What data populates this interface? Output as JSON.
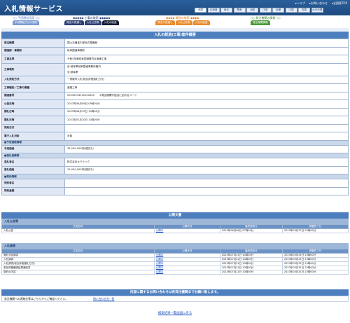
{
  "header": {
    "brand": "入札情報サービス",
    "links": [
      "▸ヘルプ",
      "▸お問い合わせ",
      "▸全国版TOP"
    ],
    "regions": [
      "全国",
      "北海道",
      "東北",
      "関東",
      "北陸",
      "中部",
      "近畿",
      "中国",
      "四国",
      "九州沖縄"
    ]
  },
  "nav": {
    "groups": [
      {
        "title": "◇◇ 手続開始画面 ◇◇",
        "tabs": [
          {
            "label": "手続開始方法の選択",
            "color": "#7a9ad0"
          }
        ],
        "color": "#5b7fc8"
      },
      {
        "title": "◆◆◆◆◆ 工事の検索 ◆◆◆◆◆",
        "tabs": [
          {
            "label": "発注の見通し",
            "color": "#2c3f73"
          },
          {
            "label": "入札公告等",
            "color": "#2c3f73"
          },
          {
            "label": "入札の経過",
            "color": "#121a33"
          }
        ],
        "color": "#2c3f73"
      },
      {
        "title": "◆◆◆◆ 業務の検索 ◆◆◆◆",
        "tabs": [
          {
            "label": "発注の見通し",
            "color": "#e88a2c"
          },
          {
            "label": "入札公告等",
            "color": "#e88a2c"
          },
          {
            "label": "入札の経過",
            "color": "#e88a2c"
          }
        ],
        "color": "#e07b1a"
      },
      {
        "title": "◇◇ 発注機関の情報 ◇◇",
        "tabs": [
          {
            "label": "発注機関情報",
            "color": "#4a9a3a"
          }
        ],
        "color": "#3d8a2e"
      }
    ]
  },
  "detail": {
    "title": "入札の経過(工事)案件概要",
    "rows": [
      {
        "type": "row",
        "label": "発注機関",
        "value": "国土交通省中部地方整備局"
      },
      {
        "type": "row",
        "label": "調達部・事務所",
        "value": "岐阜国道事務所"
      },
      {
        "type": "row",
        "label": "工事名称",
        "value": "令和5年度岐阜国道管内区画線工事"
      },
      {
        "type": "row2",
        "label": "工事場所",
        "values": [
          "自:岐阜県岐阜国道事務所管内",
          "至:岐阜県"
        ]
      },
      {
        "type": "row",
        "label": "入札契約方式",
        "value": "一般競争入札(総合評価落札方式)"
      },
      {
        "type": "row",
        "label": "工事種別／工事の業種",
        "value": "道路工事"
      },
      {
        "type": "row",
        "label": "調達番号",
        "value": "20230533510100000　　※発注機関が独自に定めるコード"
      },
      {
        "type": "row",
        "label": "公告日時",
        "value": "2023年06月06日 09時00分"
      },
      {
        "type": "row",
        "label": "開札日時",
        "value": "2023年06月15日 10時00分"
      },
      {
        "type": "row",
        "label": "開札日時",
        "value": "2023年07月20日 10時00分"
      },
      {
        "type": "row",
        "label": "契約日付",
        "value": ""
      },
      {
        "type": "row",
        "label": "電子入札対象",
        "value": "対象"
      },
      {
        "type": "sec",
        "label": "■予定価格情報"
      },
      {
        "type": "row",
        "label": "予定価格",
        "value": "35,200,000円(税抜き)"
      },
      {
        "type": "sec",
        "label": "■落札者情報"
      },
      {
        "type": "row",
        "label": "落札者名",
        "value": "株式会社キクテック"
      },
      {
        "type": "row",
        "label": "落札価格",
        "value": "31,000,000円(税抜き)"
      },
      {
        "type": "sec",
        "label": "■契約情報"
      },
      {
        "type": "row",
        "label": "契約者名",
        "value": ""
      },
      {
        "type": "row",
        "label": "契約金額",
        "value": ""
      }
    ]
  },
  "docs": {
    "title": "公開文書",
    "columns": [
      "文書名称",
      "公開状況",
      "最終更新日",
      "掲載終了日"
    ],
    "sections": [
      {
        "title": "入札公告等",
        "rows": [
          {
            "name": "入札公告",
            "status": "公開中",
            "updated": "2023年06月06日 07時00分",
            "end": "2023年03月31日 23時00分"
          }
        ]
      },
      {
        "title": "入札経過",
        "rows": [
          {
            "name": "落札決定調書",
            "status": "公開中",
            "updated": "2023年07月21日 10時00分",
            "end": "2023年03月31日 23時00分"
          },
          {
            "name": "入札調書",
            "status": "公開中",
            "updated": "2023年07月21日 10時00分",
            "end": "2023年03月31日 23時00分"
          },
          {
            "name": "入札調書(総合評価落札方式)",
            "status": "公開中",
            "updated": "2023年07月21日 10時00分",
            "end": "2023年03月31日 23時00分"
          },
          {
            "name": "参加資格確認結果通知書",
            "status": "公開中",
            "updated": "2023年07月21日 10時00分",
            "end": "2023年03月31日 23時00分"
          },
          {
            "name": "契約の内容",
            "status": "公開中",
            "updated": "2023年07月21日 10時00分",
            "end": "2023年03月31日 23時00分"
          }
        ]
      }
    ]
  },
  "contact": {
    "title": "内容に関するお問い合わせは各発注機関までお願い致します。",
    "text": "発注機関への連絡先等はこちらからご確認ください。",
    "link": "問い合わせ先一覧"
  },
  "back_link": "検索結果一覧画面に戻る"
}
